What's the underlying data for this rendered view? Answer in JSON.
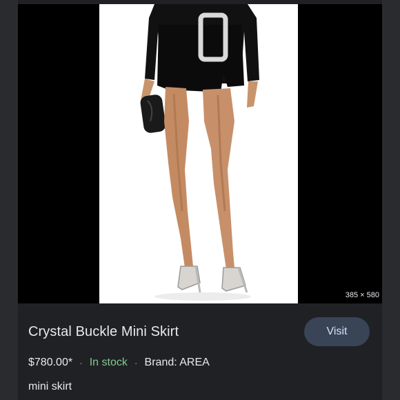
{
  "image": {
    "dimensions_label": "385 × 580"
  },
  "product": {
    "title": "Crystal Buckle Mini Skirt",
    "price": "$780.00*",
    "separator": "·",
    "stock_status": "In stock",
    "brand": "Brand: AREA",
    "category": "mini skirt"
  },
  "actions": {
    "visit_label": "Visit"
  },
  "colors": {
    "stock_green": "#81c995",
    "button_bg": "#394457",
    "button_text": "#d2e3fc",
    "panel_bg": "#202124"
  }
}
